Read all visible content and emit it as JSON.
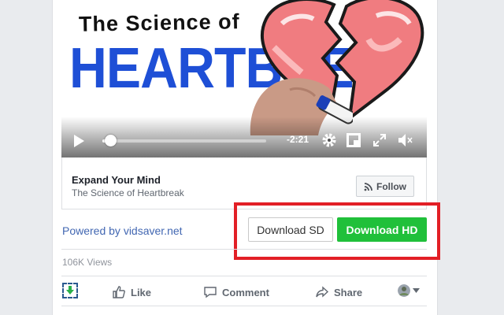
{
  "video": {
    "thumbnail_title_top": "The Science of",
    "thumbnail_title_main": "HEARTBRE",
    "time_remaining": "-2:21",
    "progress_fraction": 0.05,
    "icons": [
      "play-icon",
      "gear-icon",
      "picture-in-picture-icon",
      "fullscreen-icon",
      "mute-icon"
    ]
  },
  "page": {
    "name": "Expand Your Mind",
    "subtitle": "The Science of Heartbreak",
    "follow_label": "Follow"
  },
  "downloader": {
    "powered_by": "Powered by vidsaver.net",
    "sd_label": "Download SD",
    "hd_label": "Download HD"
  },
  "stats": {
    "views": "106K Views"
  },
  "actions": {
    "like": "Like",
    "comment": "Comment",
    "share": "Share"
  },
  "colors": {
    "link": "#4267b2",
    "hd_button": "#20c03a",
    "highlight": "#e21f26",
    "thumb_title": "#1e4fd6"
  }
}
